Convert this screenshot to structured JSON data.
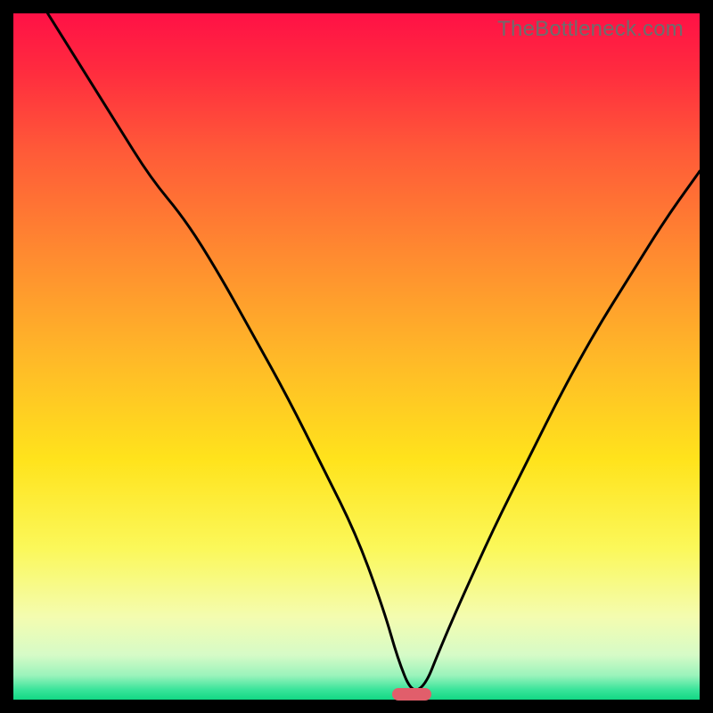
{
  "watermark": "TheBottleneck.com",
  "colors": {
    "gradient_stops": [
      {
        "offset": 0.0,
        "color": "#ff1146"
      },
      {
        "offset": 0.08,
        "color": "#ff2a3f"
      },
      {
        "offset": 0.2,
        "color": "#ff5a38"
      },
      {
        "offset": 0.35,
        "color": "#ff8a30"
      },
      {
        "offset": 0.5,
        "color": "#ffb828"
      },
      {
        "offset": 0.65,
        "color": "#ffe31c"
      },
      {
        "offset": 0.78,
        "color": "#fbf85a"
      },
      {
        "offset": 0.88,
        "color": "#f4fcb0"
      },
      {
        "offset": 0.935,
        "color": "#d6fbc7"
      },
      {
        "offset": 0.965,
        "color": "#9af3bb"
      },
      {
        "offset": 0.985,
        "color": "#3be49b"
      },
      {
        "offset": 1.0,
        "color": "#12d884"
      }
    ],
    "curve": "#000000",
    "marker": "#e15e6b",
    "frame": "#000000"
  },
  "chart_data": {
    "type": "line",
    "title": "",
    "xlabel": "",
    "ylabel": "",
    "xlim": [
      0,
      100
    ],
    "ylim": [
      0,
      100
    ],
    "optimum_x": 58,
    "series": [
      {
        "name": "bottleneck-curve",
        "x": [
          5,
          10,
          15,
          20,
          25,
          30,
          35,
          40,
          45,
          50,
          54,
          56,
          58,
          60,
          62,
          65,
          70,
          75,
          80,
          85,
          90,
          95,
          100
        ],
        "y": [
          100,
          92,
          84,
          76,
          70,
          62,
          53,
          44,
          34,
          24,
          13,
          6,
          1,
          2,
          7,
          14,
          25,
          35,
          45,
          54,
          62,
          70,
          77
        ]
      }
    ],
    "marker": {
      "x": 58,
      "y": 0.8,
      "label": "optimal-point"
    }
  }
}
